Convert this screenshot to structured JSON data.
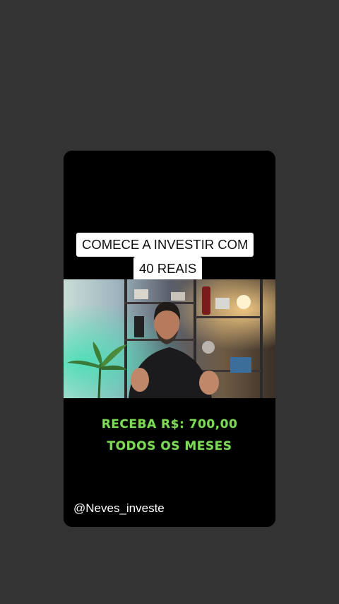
{
  "post": {
    "caption_line_1": "COMECE A INVESTIR COM",
    "caption_line_2": "40 REAIS",
    "promo_line_1": "RECEBA R$: 700,00",
    "promo_line_2": "TODOS OS MESES",
    "handle": "@Neves_investe"
  },
  "colors": {
    "background": "#333333",
    "card": "#000000",
    "promo_text": "#7ed957",
    "caption_bg": "#ffffff"
  }
}
